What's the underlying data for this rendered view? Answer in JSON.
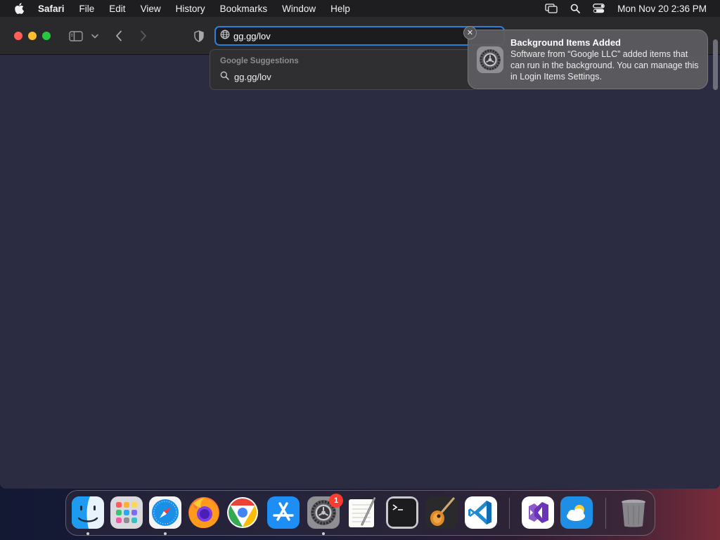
{
  "menubar": {
    "app_name": "Safari",
    "items": [
      "File",
      "Edit",
      "View",
      "History",
      "Bookmarks",
      "Window",
      "Help"
    ],
    "clock": "Mon Nov 20  2:36 PM",
    "status_icons": [
      "screen-mirroring-icon",
      "spotlight-search-icon",
      "control-center-icon"
    ]
  },
  "safari": {
    "address_value": "gg.gg/lov",
    "suggestions": {
      "heading": "Google Suggestions",
      "items": [
        "gg.gg/lov"
      ]
    }
  },
  "notification": {
    "title": "Background Items Added",
    "body": "Software from “Google LLC” added items that can run in the background. You can manage this in Login Items Settings.",
    "close_glyph": "✕",
    "icon": "system-settings-icon"
  },
  "dock": {
    "apps": [
      {
        "name": "finder",
        "running": true
      },
      {
        "name": "launchpad",
        "running": false
      },
      {
        "name": "safari",
        "running": true
      },
      {
        "name": "firefox",
        "running": false
      },
      {
        "name": "chrome",
        "running": false
      },
      {
        "name": "app-store",
        "running": false
      },
      {
        "name": "system-settings",
        "running": true,
        "badge": "1"
      },
      {
        "name": "textedit",
        "running": false
      },
      {
        "name": "terminal",
        "running": false
      },
      {
        "name": "garageband",
        "running": false
      },
      {
        "name": "vscode",
        "running": false
      },
      {
        "name": "visual-studio",
        "running": false
      },
      {
        "name": "weather",
        "running": false
      },
      {
        "name": "trash",
        "running": false
      }
    ]
  },
  "colors": {
    "accent": "#2b7fd6",
    "page_background": "#2b2b41",
    "close": "#ff5f57",
    "minimize": "#febc2e",
    "maximize": "#28c840",
    "badge": "#ff3b30"
  }
}
